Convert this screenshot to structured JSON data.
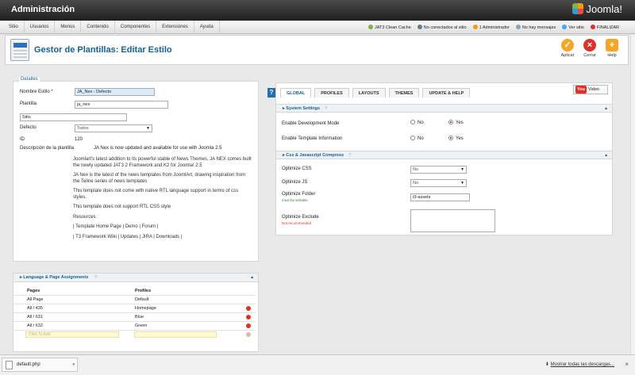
{
  "header": {
    "title": "Administración",
    "logo_text": "Joomla!"
  },
  "menu": {
    "items": [
      "Sitio",
      "Usuarios",
      "Menús",
      "Contenido",
      "Componentes",
      "Extensiones",
      "Ayuda"
    ],
    "status": {
      "cache": "JAT3 Clean Cache",
      "site": "No conectados al sitio",
      "admin": "1 Administrador",
      "messages": "No hay mensajes",
      "view_site": "Ver sitio",
      "logout": "FINALIZAR"
    }
  },
  "toolbar": {
    "title": "Gestor de Plantillas: Editar Estilo",
    "apply": "Aplicar",
    "close": "Cerrar",
    "help": "Help"
  },
  "details": {
    "legend": "Detalles",
    "style_name_label": "Nombre Estilo *",
    "style_name_value": "JA_Nex - Defecto",
    "template_label": "Plantilla",
    "template_value": "ja_nex",
    "site_value": "Sitio",
    "default_label": "Defecto",
    "default_value": "Todos",
    "id_label": "ID",
    "id_value": "120",
    "desc_label": "Descripción de la plantilla",
    "desc_first": "JA Nex is now updated and available for use with Joomla 2.5",
    "desc_p1": "Joomlart's latest addition to its powerful stable of News Themes, JA NEX comes built the newly updated JAT3 2 Framework and K2 for Joomla! 2.5",
    "desc_p2": "JA Nex is the latest of the news templates from JoomlArt, drawing inspiration from the Teline series of news templates",
    "desc_p3": "This template does not come with native RTL language support in terms of css styles.",
    "desc_p4": "This template does not support RTL CSS style",
    "resources": "Resources :",
    "links1": "| Template Home Page | Demo | Forum |",
    "links2": "| T3 Framework Wiki | Updates | JIRA | Downloads |"
  },
  "assignments": {
    "title": "Language & Page Assignments",
    "help": "?",
    "col_pages": "Pages",
    "col_profiles": "Profiles",
    "rows": [
      {
        "page": "All Page",
        "profile": "Default"
      },
      {
        "page": "All / 435",
        "profile": "Homepage"
      },
      {
        "page": "All / 631",
        "profile": "Blue"
      },
      {
        "page": "All / 632",
        "profile": "Green"
      }
    ],
    "add_placeholder": "Click To Add"
  },
  "config": {
    "help_button": "?",
    "tabs": [
      "GLOBAL",
      "PROFILES",
      "LAYOUTS",
      "THEMES",
      "UPDATE & HELP"
    ],
    "video_brand": "You",
    "video_label": "Video",
    "system_section": "System Settings",
    "dev_mode_label": "Enable Development Mode",
    "template_info_label": "Enable Template Information",
    "no": "No",
    "yes": "Yes",
    "compress_section": "Css & Javascript Compress",
    "optimize_css_label": "Optimize CSS",
    "optimize_css_value": "No",
    "optimize_js_label": "Optimize JS",
    "optimize_js_value": "No",
    "optimize_folder_label": "Optimize Folder",
    "optimize_folder_hint": "must be writable",
    "optimize_folder_value": "t3-assets",
    "optimize_exclude_label": "Optimize Exclude",
    "optimize_exclude_hint": "Not recommended",
    "help": "?",
    "dev_mode": "Yes",
    "template_info": "Yes"
  },
  "download": {
    "file": "default.php",
    "show_all": "Mostrar todas las descargas...",
    "close": "×"
  },
  "colors": {
    "accent": "#146295",
    "danger": "#d9342b",
    "apply": "#f5a623"
  }
}
